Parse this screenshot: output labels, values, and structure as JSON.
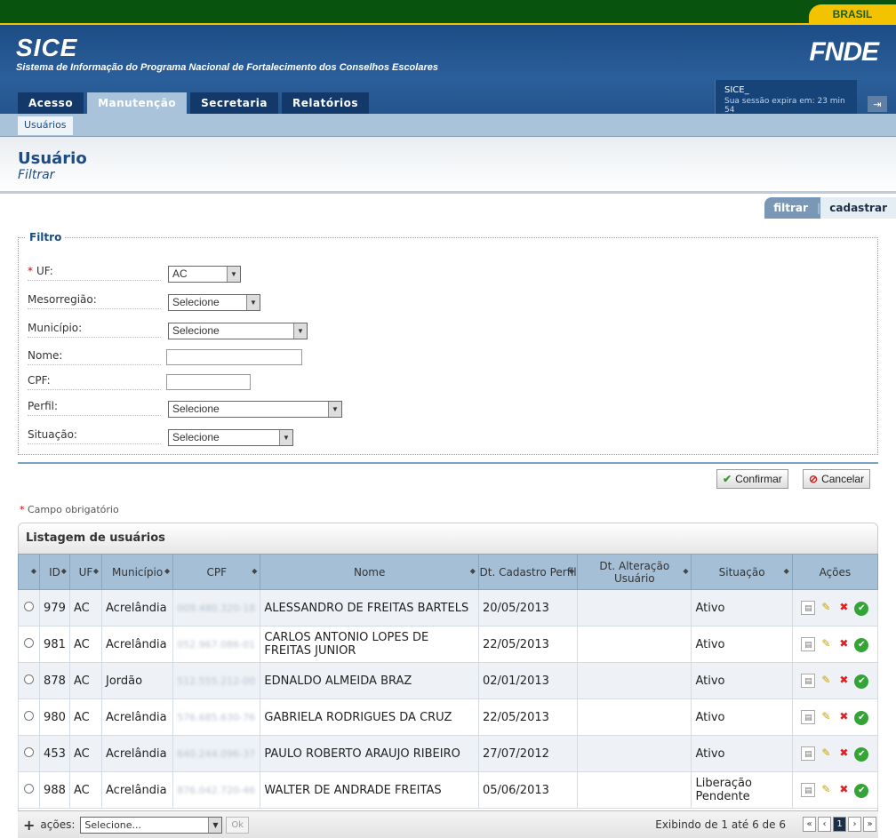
{
  "gov": {
    "brasil": "BRASIL"
  },
  "header": {
    "logo": "SICE",
    "subtitle": "Sistema de Informação do Programa Nacional de Fortalecimento dos Conselhos Escolares",
    "brand": "FNDE",
    "session_user": "SICE_",
    "session_expiry": "Sua sessão expira em: 23 min 54"
  },
  "tabs": [
    {
      "label": "Acesso"
    },
    {
      "label": "Manutenção"
    },
    {
      "label": "Secretaria"
    },
    {
      "label": "Relatórios"
    }
  ],
  "subnav": {
    "item": "Usuários"
  },
  "page": {
    "title": "Usuário",
    "subtitle": "Filtrar"
  },
  "actions": {
    "filter": "filtrar",
    "create": "cadastrar"
  },
  "filter": {
    "legend": "Filtro",
    "uf": {
      "label": "UF:",
      "value": "AC"
    },
    "meso": {
      "label": "Mesorregião:",
      "value": "Selecione"
    },
    "municipio": {
      "label": "Município:",
      "value": "Selecione"
    },
    "nome": {
      "label": "Nome:",
      "value": ""
    },
    "cpf": {
      "label": "CPF:",
      "value": ""
    },
    "perfil": {
      "label": "Perfil:",
      "value": "Selecione"
    },
    "situacao": {
      "label": "Situação:",
      "value": "Selecione"
    }
  },
  "buttons": {
    "confirm": "Confirmar",
    "cancel": "Cancelar"
  },
  "required_note": "Campo obrigatório",
  "list": {
    "title": "Listagem de usuários",
    "columns": [
      "ID",
      "UF",
      "Município",
      "CPF",
      "Nome",
      "Dt. Cadastro Perfil",
      "Dt. Alteração Usuário",
      "Situação",
      "Ações"
    ],
    "rows": [
      {
        "id": "979",
        "uf": "AC",
        "municipio": "Acrelândia",
        "cpf": "009.480.320-18",
        "nome": "ALESSANDRO DE FREITAS BARTELS",
        "dt_cad": "20/05/2013",
        "dt_alt": "",
        "situacao": "Ativo"
      },
      {
        "id": "981",
        "uf": "AC",
        "municipio": "Acrelândia",
        "cpf": "052.967.086-01",
        "nome": "CARLOS ANTONIO LOPES DE FREITAS JUNIOR",
        "dt_cad": "22/05/2013",
        "dt_alt": "",
        "situacao": "Ativo"
      },
      {
        "id": "878",
        "uf": "AC",
        "municipio": "Jordão",
        "cpf": "512.555.212-00",
        "nome": "EDNALDO ALMEIDA BRAZ",
        "dt_cad": "02/01/2013",
        "dt_alt": "",
        "situacao": "Ativo"
      },
      {
        "id": "980",
        "uf": "AC",
        "municipio": "Acrelândia",
        "cpf": "576.685.630-76",
        "nome": "GABRIELA RODRIGUES DA CRUZ",
        "dt_cad": "22/05/2013",
        "dt_alt": "",
        "situacao": "Ativo"
      },
      {
        "id": "453",
        "uf": "AC",
        "municipio": "Acrelândia",
        "cpf": "640.244.096-37",
        "nome": "PAULO ROBERTO ARAUJO RIBEIRO",
        "dt_cad": "27/07/2012",
        "dt_alt": "",
        "situacao": "Ativo"
      },
      {
        "id": "988",
        "uf": "AC",
        "municipio": "Acrelândia",
        "cpf": "876.042.720-46",
        "nome": "WALTER DE ANDRADE FREITAS",
        "dt_cad": "05/06/2013",
        "dt_alt": "",
        "situacao": "Liberação Pendente"
      }
    ]
  },
  "footer": {
    "actions_label": "ações:",
    "actions_value": "Selecione...",
    "ok": "Ok",
    "showing": "Exibindo de 1 até 6 de 6",
    "page": "1"
  }
}
